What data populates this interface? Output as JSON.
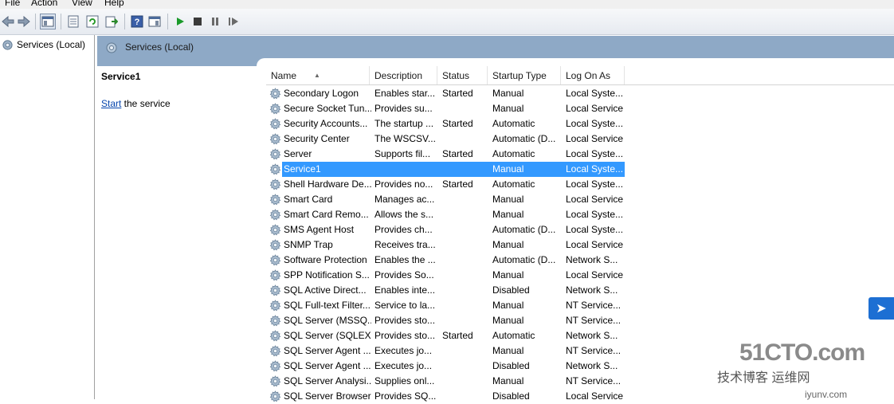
{
  "menu": [
    "File",
    "Action",
    "View",
    "Help"
  ],
  "tree": {
    "label": "Services (Local)"
  },
  "pane_header": {
    "title": "Services (Local)"
  },
  "ext_pane": {
    "title": "Service1",
    "action_link": "Start",
    "action_rest": " the service"
  },
  "columns": [
    "Name",
    "Description",
    "Status",
    "Startup Type",
    "Log On As"
  ],
  "rows": [
    {
      "name": "Secondary Logon",
      "desc": "Enables star...",
      "status": "Started",
      "startup": "Manual",
      "logon": "Local Syste..."
    },
    {
      "name": "Secure Socket Tun...",
      "desc": "Provides su...",
      "status": "",
      "startup": "Manual",
      "logon": "Local Service"
    },
    {
      "name": "Security Accounts...",
      "desc": "The startup ...",
      "status": "Started",
      "startup": "Automatic",
      "logon": "Local Syste..."
    },
    {
      "name": "Security Center",
      "desc": "The WSCSV...",
      "status": "",
      "startup": "Automatic (D...",
      "logon": "Local Service"
    },
    {
      "name": "Server",
      "desc": "Supports fil...",
      "status": "Started",
      "startup": "Automatic",
      "logon": "Local Syste..."
    },
    {
      "name": "Service1",
      "desc": "",
      "status": "",
      "startup": "Manual",
      "logon": "Local Syste...",
      "selected": true
    },
    {
      "name": "Shell Hardware De...",
      "desc": "Provides no...",
      "status": "Started",
      "startup": "Automatic",
      "logon": "Local Syste..."
    },
    {
      "name": "Smart Card",
      "desc": "Manages ac...",
      "status": "",
      "startup": "Manual",
      "logon": "Local Service"
    },
    {
      "name": "Smart Card Remo...",
      "desc": "Allows the s...",
      "status": "",
      "startup": "Manual",
      "logon": "Local Syste..."
    },
    {
      "name": "SMS Agent Host",
      "desc": "Provides ch...",
      "status": "",
      "startup": "Automatic (D...",
      "logon": "Local Syste..."
    },
    {
      "name": "SNMP Trap",
      "desc": "Receives tra...",
      "status": "",
      "startup": "Manual",
      "logon": "Local Service"
    },
    {
      "name": "Software Protection",
      "desc": "Enables the ...",
      "status": "",
      "startup": "Automatic (D...",
      "logon": "Network S..."
    },
    {
      "name": "SPP Notification S...",
      "desc": "Provides So...",
      "status": "",
      "startup": "Manual",
      "logon": "Local Service"
    },
    {
      "name": "SQL Active Direct...",
      "desc": "Enables inte...",
      "status": "",
      "startup": "Disabled",
      "logon": "Network S..."
    },
    {
      "name": "SQL Full-text Filter...",
      "desc": "Service to la...",
      "status": "",
      "startup": "Manual",
      "logon": "NT Service..."
    },
    {
      "name": "SQL Server (MSSQ...",
      "desc": "Provides sto...",
      "status": "",
      "startup": "Manual",
      "logon": "NT Service..."
    },
    {
      "name": "SQL Server (SQLEX...",
      "desc": "Provides sto...",
      "status": "Started",
      "startup": "Automatic",
      "logon": "Network S..."
    },
    {
      "name": "SQL Server Agent ...",
      "desc": "Executes jo...",
      "status": "",
      "startup": "Manual",
      "logon": "NT Service..."
    },
    {
      "name": "SQL Server Agent ...",
      "desc": "Executes jo...",
      "status": "",
      "startup": "Disabled",
      "logon": "Network S..."
    },
    {
      "name": "SQL Server Analysi...",
      "desc": "Supplies onl...",
      "status": "",
      "startup": "Manual",
      "logon": "NT Service..."
    },
    {
      "name": "SQL Server Browser",
      "desc": "Provides SQ...",
      "status": "",
      "startup": "Disabled",
      "logon": "Local Service"
    }
  ],
  "watermark": {
    "brand": "51CTO.com",
    "tagline": "技术博客 运维网",
    "site": "iyunv.com"
  },
  "colors": {
    "selection": "#3399ff",
    "header_bar": "#8ea9c6"
  },
  "icons": {
    "service": "gear-icon"
  }
}
